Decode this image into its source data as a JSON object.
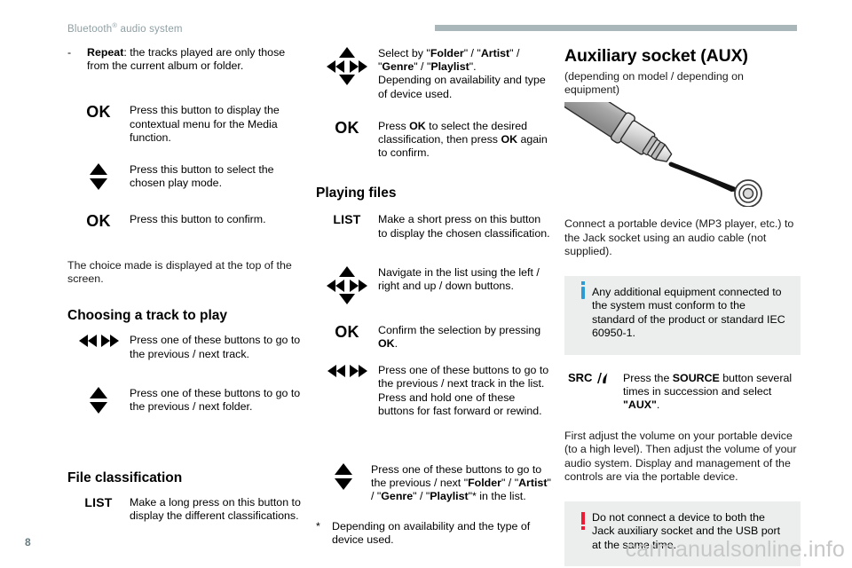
{
  "header": {
    "title_main": "Bluetooth",
    "title_sup": "®",
    "title_rest": " audio system"
  },
  "column1": {
    "repeat_item": {
      "dash": "-",
      "label": "Repeat",
      "text": ": the tracks played are only those from the current album or folder."
    },
    "rows": [
      {
        "icon": "ok-button-icon",
        "label": "OK",
        "text": "Press this button to display the contextual menu for the Media function."
      },
      {
        "icon": "up-down-arrows-icon",
        "label": "",
        "text": "Press this button to select the chosen play mode."
      },
      {
        "icon": "ok-button-icon",
        "label": "OK",
        "text": "Press this button to confirm."
      }
    ],
    "choice_paragraph": "The choice made is displayed at the top of the screen.",
    "heading_choosing": "Choosing a track to play",
    "choosing_rows": [
      {
        "icon": "prev-next-arrows-icon",
        "text": "Press one of these buttons to go to the previous / next track."
      },
      {
        "icon": "up-down-arrows-icon",
        "text": "Press one of these buttons to go to the previous / next folder."
      }
    ],
    "heading_file_classification": "File classification",
    "file_row": {
      "icon": "list-button-icon",
      "label": "LIST",
      "text": "Make a long press on this button to display the different classifications."
    }
  },
  "column2": {
    "select_row": {
      "icon": "four-way-arrows-icon",
      "line1_pre": "Select by \"",
      "line1_b1": "Folder",
      "line1_mid1": "\" / \"",
      "line1_b2": "Artist",
      "line1_mid2": "\" / \"",
      "line1_b3": "Genre",
      "line1_mid3": "\" / \"",
      "line1_b4": "Playlist",
      "line1_post": "\".",
      "line2": "Depending on availability and type of device used."
    },
    "ok_row": {
      "icon": "ok-button-icon",
      "label": "OK",
      "pre": "Press ",
      "b1": "OK",
      "mid": " to select the desired classification, then press ",
      "b2": "OK",
      "post": " again to confirm."
    },
    "heading_playing_files": "Playing files",
    "rows": [
      {
        "icon": "list-button-icon",
        "label": "LIST",
        "text": "Make a short press on this button to display the chosen classification."
      },
      {
        "icon": "four-way-arrows-icon",
        "label": "",
        "text": "Navigate in the list using the left / right and up / down buttons."
      }
    ],
    "confirm_row": {
      "icon": "ok-button-icon",
      "label": "OK",
      "pre": "Confirm the selection by pressing ",
      "b1": "OK",
      "post": "."
    },
    "prev_next_row": {
      "icon": "prev-next-arrows-icon",
      "text": "Press one of these buttons to go to the previous / next track in the list. Press and hold one of these buttons for fast forward or rewind."
    },
    "folder_row": {
      "icon": "up-down-arrows-icon",
      "pre": "Press one of these buttons to go to the previous / next \"",
      "b1": "Folder",
      "mid1": "\" / \"",
      "b2": "Artist",
      "mid2": "\" / \"",
      "b3": "Genre",
      "mid3": "\" / \"",
      "b4": "Playlist",
      "post": "\"* in the list."
    },
    "footnote": {
      "marker": "*",
      "text": "Depending on availability and the type of device used."
    }
  },
  "column3": {
    "heading": "Auxiliary socket (AUX)",
    "subheading": "(depending on model / depending on equipment)",
    "illustration": "aux-jack-plug-illustration",
    "connect_paragraph": "Connect a portable device (MP3 player, etc.) to the Jack socket using an audio cable (not supplied).",
    "info_note": {
      "icon": "info-icon",
      "text": "Any additional equipment connected to the system must conform to the standard of the product or standard IEC 60950-1."
    },
    "source_row": {
      "icon": "src-button-icon",
      "label": "SRC",
      "pre": "Press the ",
      "b1": "SOURCE",
      "mid": " button several times in succession and select ",
      "b2": "\"AUX\"",
      "post": "."
    },
    "volume_paragraph": "First adjust the volume on your portable device (to a high level). Then adjust the volume of your audio system. Display and management of the controls are via the portable device.",
    "warning_note": {
      "icon": "warning-icon",
      "text": "Do not connect a device to both the Jack auxiliary socket and the USB port at the same time."
    }
  },
  "footer": {
    "page_number": "8",
    "watermark": "carmanualsonline.info"
  },
  "colors": {
    "header_text": "#8e9fa3",
    "header_rule": "#a9b7ba",
    "note_background": "#eceeee",
    "info_accent": "#2f9bd4",
    "warning_accent": "#ed1c36",
    "page_number": "#667b80",
    "watermark": "#c7c7c7"
  }
}
